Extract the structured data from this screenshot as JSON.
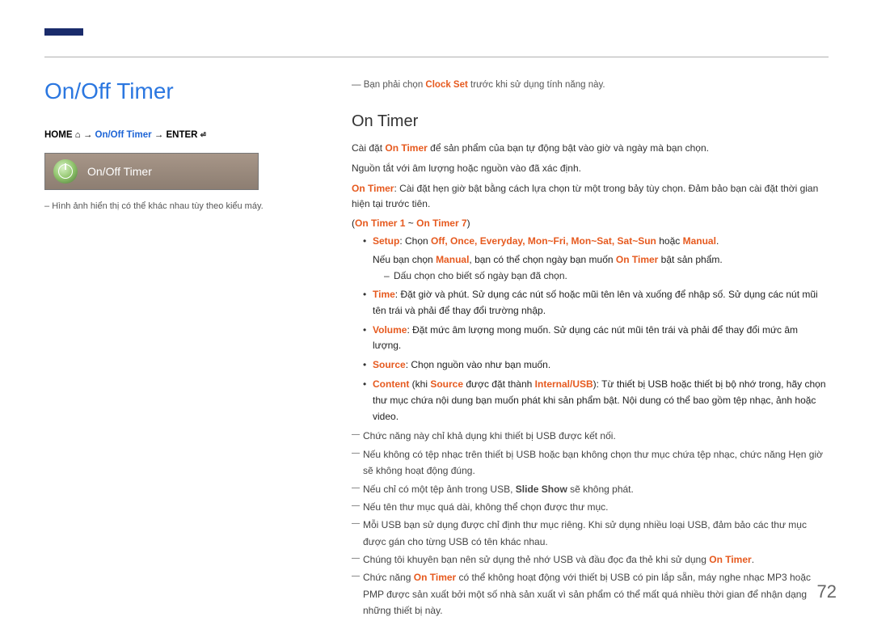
{
  "title": "On/Off Timer",
  "breadcrumb": {
    "home": "HOME",
    "path": "On/Off Timer",
    "enter": "ENTER"
  },
  "tile_label": "On/Off Timer",
  "left_note_prefix": "– ",
  "left_note": "Hình ảnh hiển thị có thể khác nhau tùy theo kiểu máy.",
  "prelude_prefix": "― Bạn phải chọn ",
  "prelude_hl": "Clock Set",
  "prelude_suffix": " trước khi sử dụng tính năng này.",
  "section": "On Timer",
  "p1_a": "Cài đặt ",
  "p1_hl": "On Timer",
  "p1_b": " để sản phẩm của bạn tự động bật vào giờ và ngày mà bạn chọn.",
  "p2": "Nguồn tắt với âm lượng hoặc nguồn vào đã xác định.",
  "p3_hl": "On Timer",
  "p3_b": ": Cài đặt hẹn giờ bật bằng cách lựa chọn từ một trong bảy tùy chọn. Đảm bảo bạn cài đặt thời gian hiện tại trước tiên.",
  "range_a": "On Timer 1",
  "range_sep": " ~ ",
  "range_b": "On Timer 7",
  "opt_setup_label": "Setup",
  "opt_setup_text1": ": Chọn ",
  "opt_setup_vals": "Off, Once, Everyday, Mon~Fri, Mon~Sat, Sat~Sun",
  "opt_setup_text2": " hoặc ",
  "opt_setup_manual": "Manual",
  "opt_setup_sub_a": "Nếu bạn chọn ",
  "opt_setup_sub_hl1": "Manual",
  "opt_setup_sub_b": ", bạn có thể chọn ngày bạn muốn ",
  "opt_setup_sub_hl2": "On Timer",
  "opt_setup_sub_c": " bật sản phẩm.",
  "opt_setup_note": "Dấu chọn cho biết số ngày bạn đã chọn.",
  "opt_time_label": "Time",
  "opt_time_text": ": Đặt giờ và phút. Sử dụng các nút số hoặc mũi tên lên và xuống để nhập số. Sử dụng các nút mũi tên trái và phải để thay đổi trường nhập.",
  "opt_vol_label": "Volume",
  "opt_vol_text": ": Đặt mức âm lượng mong muốn. Sử dụng các nút mũi tên trái và phải để thay đổi mức âm lượng.",
  "opt_src_label": "Source",
  "opt_src_text": ": Chọn nguồn vào như bạn muốn.",
  "opt_content_label": "Content",
  "opt_content_a": " (khi ",
  "opt_content_hl1": "Source",
  "opt_content_b": " được đặt thành ",
  "opt_content_hl2": "Internal/USB",
  "opt_content_c": "): Từ thiết bị USB hoặc thiết bị bộ nhớ trong, hãy chọn thư mục chứa nội dung bạn muốn phát khi sản phẩm bật. Nội dung có thể bao gồm tệp nhạc, ảnh hoặc video.",
  "notes": {
    "n1": "Chức năng này chỉ khả dụng khi thiết bị USB được kết nối.",
    "n2": "Nếu không có tệp nhạc trên thiết bị USB hoặc bạn không chọn thư mục chứa tệp nhạc, chức năng Hẹn giờ sẽ không hoạt động đúng.",
    "n3_a": "Nếu chỉ có một tệp ảnh trong USB, ",
    "n3_hl": "Slide Show",
    "n3_b": " sẽ không phát.",
    "n4": "Nếu tên thư mục quá dài, không thể chọn được thư mục.",
    "n5": "Mỗi USB bạn sử dụng được chỉ định thư mục riêng. Khi sử dụng nhiều loại USB, đảm bảo các thư mục được gán cho từng USB có tên khác nhau.",
    "n6_a": "Chúng tôi khuyên bạn nên sử dụng thẻ nhớ USB và đầu đọc đa thẻ khi sử dụng ",
    "n6_hl": "On Timer",
    "n6_b": ".",
    "n7_a": "Chức năng ",
    "n7_hl": "On Timer",
    "n7_b": " có thể không hoạt động với thiết bị USB có pin lắp sẵn, máy nghe nhạc MP3 hoặc PMP được sản xuất bởi một số nhà sản xuất vì sản phẩm có thể mất quá nhiều thời gian để nhận dạng những thiết bị này."
  },
  "page_number": "72"
}
